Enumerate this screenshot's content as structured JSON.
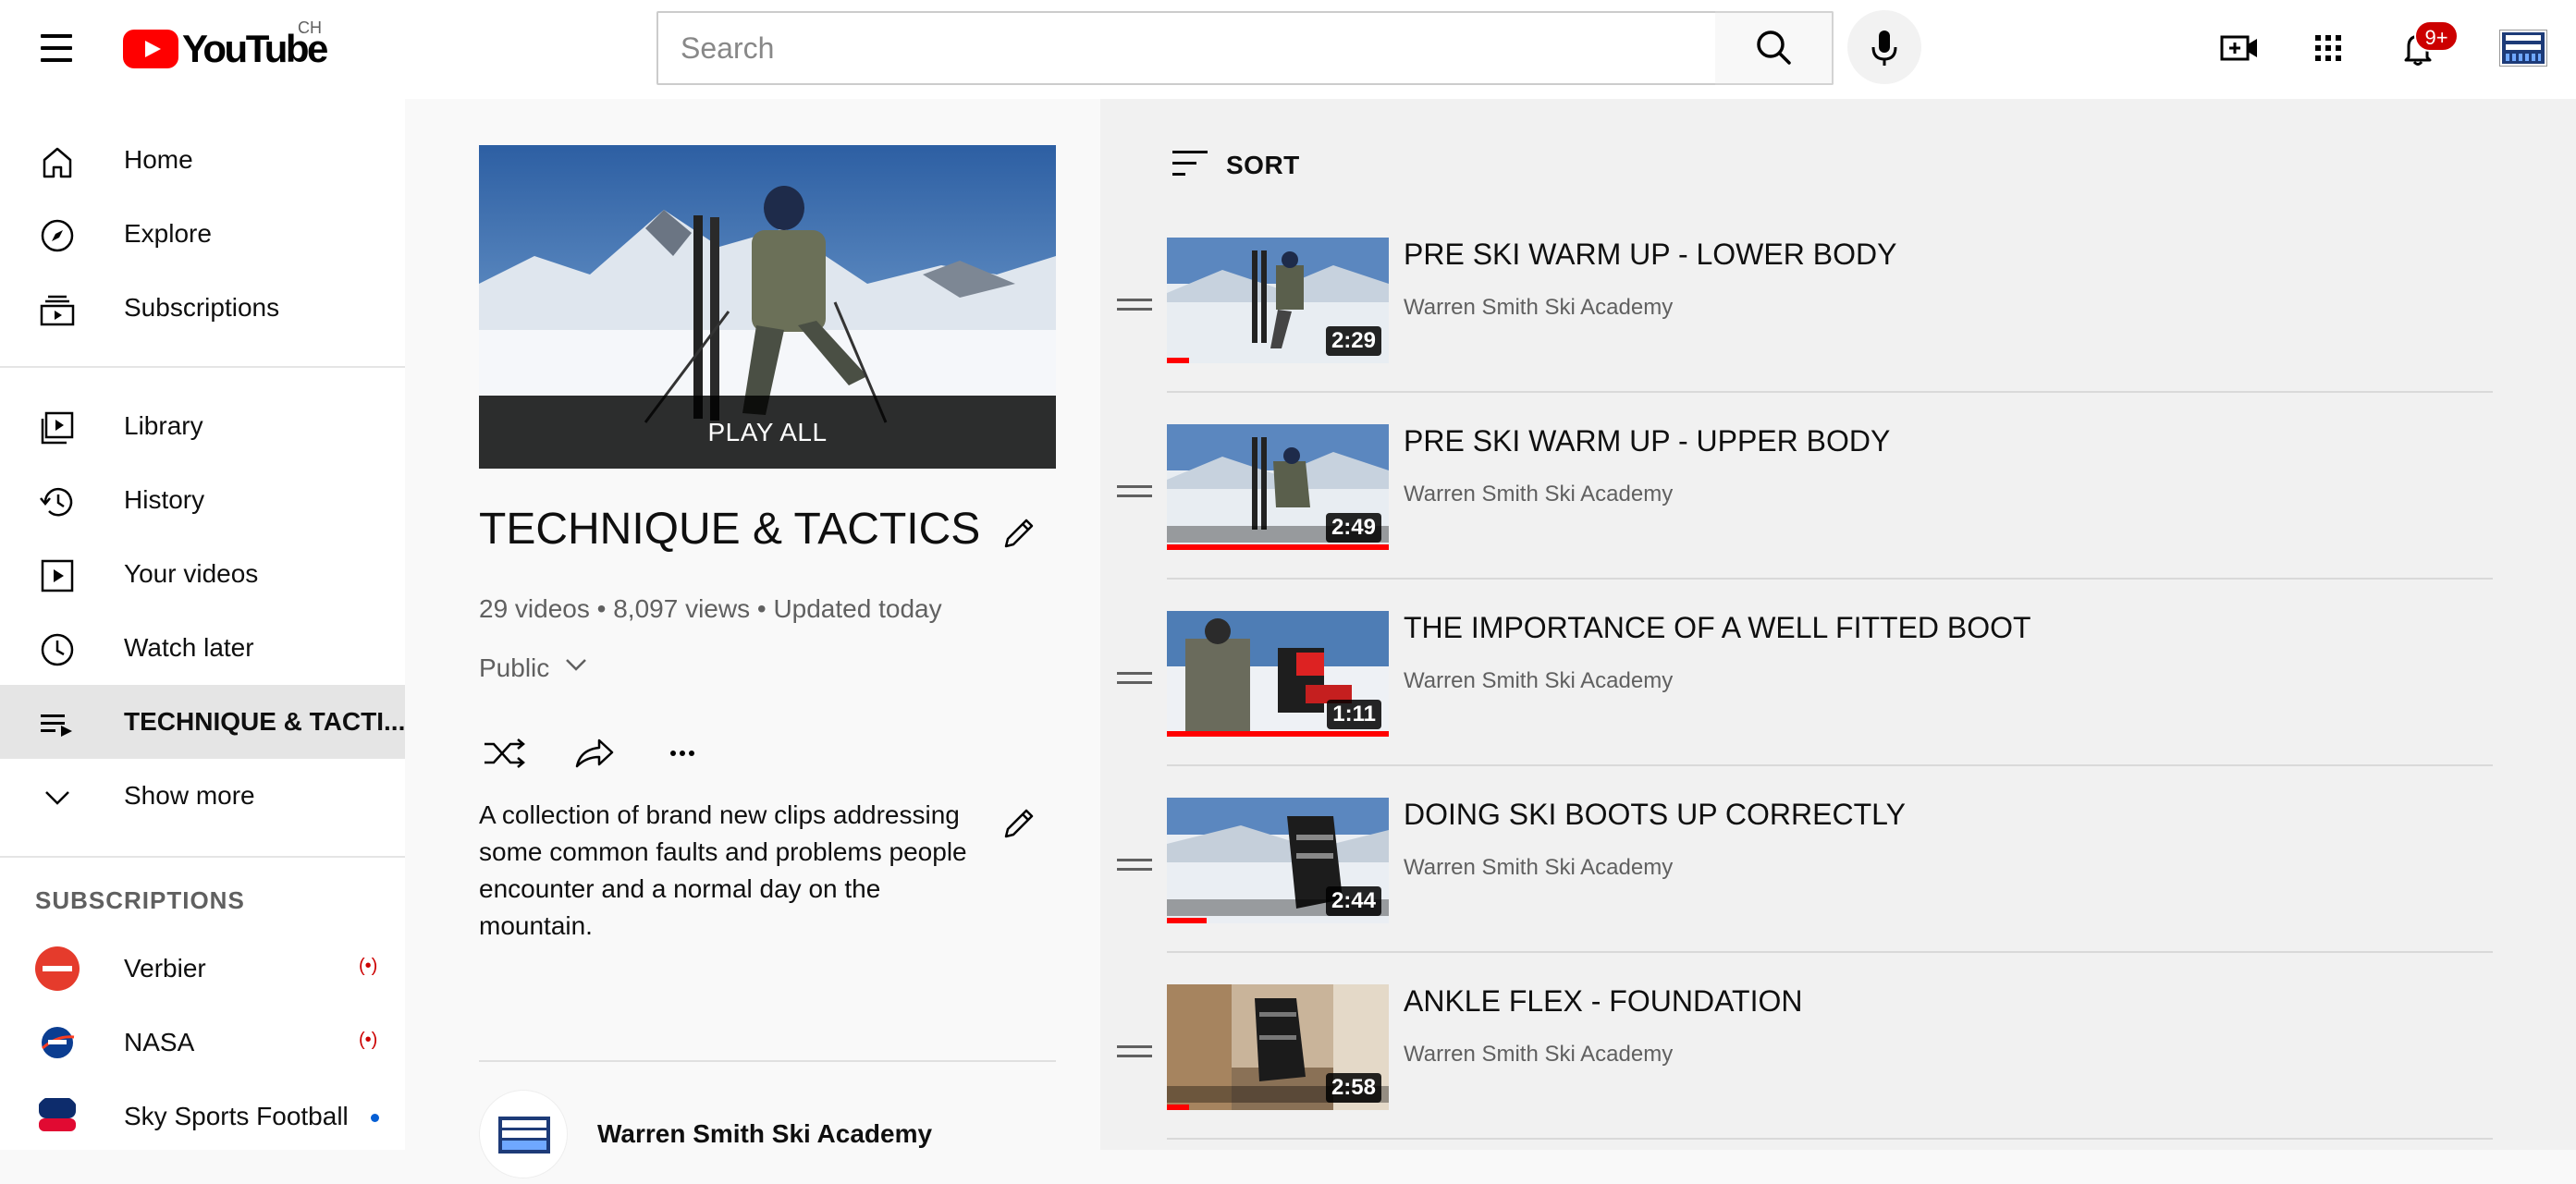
{
  "header": {
    "logo_text": "YouTube",
    "country": "CH",
    "search_placeholder": "Search",
    "notifications_badge": "9+"
  },
  "sidebar": {
    "primary": [
      {
        "label": "Home",
        "icon": "home-icon"
      },
      {
        "label": "Explore",
        "icon": "compass-icon"
      },
      {
        "label": "Subscriptions",
        "icon": "subscriptions-icon"
      }
    ],
    "secondary": [
      {
        "label": "Library",
        "icon": "library-icon"
      },
      {
        "label": "History",
        "icon": "history-icon"
      },
      {
        "label": "Your videos",
        "icon": "your-videos-icon"
      },
      {
        "label": "Watch later",
        "icon": "clock-icon"
      },
      {
        "label": "TECHNIQUE & TACTI...",
        "icon": "playlist-icon",
        "active": true
      },
      {
        "label": "Show more",
        "icon": "chevron-down-icon"
      }
    ],
    "subscriptions_title": "SUBSCRIPTIONS",
    "subscriptions": [
      {
        "name": "Verbier",
        "status": "live"
      },
      {
        "name": "NASA",
        "status": "live"
      },
      {
        "name": "Sky Sports Football",
        "status": "new"
      }
    ]
  },
  "playlist": {
    "play_all": "PLAY ALL",
    "title": "TECHNIQUE & TACTICS",
    "stats": "29 videos • 8,097 views • Updated today",
    "privacy": "Public",
    "description": "A collection of brand new clips addressing some common faults and problems people encounter and a normal day on the mountain.",
    "owner": "Warren Smith Ski Academy"
  },
  "list": {
    "sort_label": "SORT",
    "videos": [
      {
        "title": "PRE SKI WARM UP - LOWER BODY",
        "channel": "Warren Smith Ski Academy",
        "duration": "2:29",
        "progress": 0.1
      },
      {
        "title": "PRE SKI WARM UP - UPPER BODY",
        "channel": "Warren Smith Ski Academy",
        "duration": "2:49",
        "progress": 1.0
      },
      {
        "title": "THE IMPORTANCE OF A WELL FITTED BOOT",
        "channel": "Warren Smith Ski Academy",
        "duration": "1:11",
        "progress": 1.0
      },
      {
        "title": "DOING SKI BOOTS UP CORRECTLY",
        "channel": "Warren Smith Ski Academy",
        "duration": "2:44",
        "progress": 0.18
      },
      {
        "title": "ANKLE FLEX - FOUNDATION",
        "channel": "Warren Smith Ski Academy",
        "duration": "2:58",
        "progress": 0.1
      }
    ]
  },
  "colors": {
    "brand_red": "#ff0000",
    "progress_red": "#ff0000",
    "badge_red": "#cc0000",
    "active_bg": "#e5e5e5"
  }
}
